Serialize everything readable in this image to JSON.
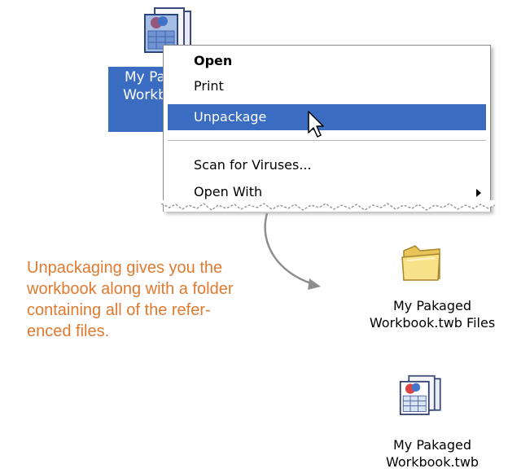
{
  "selected_icon": {
    "label_line1": "My Pa",
    "label_line2": "Workb"
  },
  "context_menu": {
    "items": [
      {
        "label": "Open"
      },
      {
        "label": "Print"
      },
      {
        "label": "Unpackage"
      },
      {
        "label": "Scan for Viruses..."
      },
      {
        "label": "Open With"
      }
    ]
  },
  "callout": {
    "line1": "Unpackaging gives you the",
    "line2": "workbook along with a folder",
    "line3": "containing all of the refer-",
    "line4": "enced files."
  },
  "output_files": [
    {
      "label_line1": "My Pakaged",
      "label_line2": "Workbook.twb Files",
      "icon": "folder-icon"
    },
    {
      "label_line1": "My Pakaged",
      "label_line2": "Workbook.twb",
      "icon": "workbook-icon"
    }
  ],
  "colors": {
    "selection": "#3a6cc2",
    "callout_text": "#e07a2f"
  }
}
